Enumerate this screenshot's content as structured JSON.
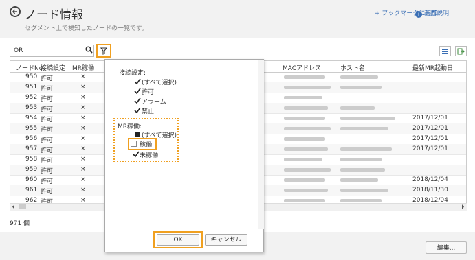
{
  "header": {
    "title": "ノード情報",
    "subtitle": "セグメント上で検知したノードの一覧です。",
    "bookmark_label": "+ ブックマークに追加",
    "help_label": "画面説明",
    "help_icon_text": "i"
  },
  "toolbar": {
    "search_value": "OR"
  },
  "grid": {
    "columns": [
      "ノードNo",
      "接続設定",
      "MR稼働",
      "MACアドレス",
      "ホスト名",
      "最新MR起動日"
    ],
    "rows": [
      {
        "no": "950",
        "conn": "許可",
        "mr": "×",
        "date": ""
      },
      {
        "no": "951",
        "conn": "許可",
        "mr": "×",
        "date": ""
      },
      {
        "no": "952",
        "conn": "許可",
        "mr": "×",
        "date": ""
      },
      {
        "no": "953",
        "conn": "許可",
        "mr": "×",
        "date": ""
      },
      {
        "no": "954",
        "conn": "許可",
        "mr": "×",
        "date": "2017/12/01"
      },
      {
        "no": "955",
        "conn": "許可",
        "mr": "×",
        "date": "2017/12/01"
      },
      {
        "no": "956",
        "conn": "許可",
        "mr": "×",
        "date": "2017/12/01"
      },
      {
        "no": "957",
        "conn": "許可",
        "mr": "×",
        "date": "2017/12/01"
      },
      {
        "no": "958",
        "conn": "許可",
        "mr": "×",
        "date": ""
      },
      {
        "no": "959",
        "conn": "許可",
        "mr": "×",
        "date": ""
      },
      {
        "no": "960",
        "conn": "許可",
        "mr": "×",
        "date": "2018/12/04"
      },
      {
        "no": "961",
        "conn": "許可",
        "mr": "×",
        "date": "2018/11/30"
      },
      {
        "no": "962",
        "conn": "許可",
        "mr": "×",
        "date": "2018/12/04"
      }
    ]
  },
  "count_label": "971 個",
  "edit_button": "編集...",
  "filter_popup": {
    "conn_heading": "接続設定:",
    "conn_options": [
      "(すべて選択)",
      "許可",
      "アラーム",
      "禁止"
    ],
    "mr_heading": "MR稼働:",
    "mr_options": [
      "(すべて選択)",
      "稼働",
      "未稼働"
    ],
    "ok_label": "OK",
    "cancel_label": "キャンセル"
  },
  "colors": {
    "highlight": "#f0a020",
    "link": "#3a6fb5"
  }
}
